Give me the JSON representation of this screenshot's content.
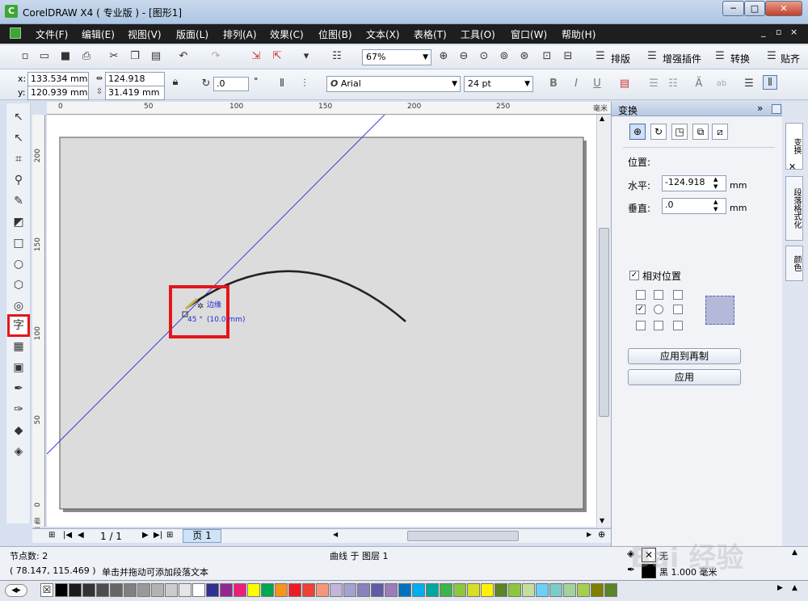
{
  "title": "CorelDRAW X4 ( 专业版 ) - [图形1]",
  "window_buttons": {
    "minimize": "─",
    "maximize": "□",
    "close": "✕"
  },
  "menu": [
    "文件(F)",
    "编辑(E)",
    "视图(V)",
    "版面(L)",
    "排列(A)",
    "效果(C)",
    "位图(B)",
    "文本(X)",
    "表格(T)",
    "工具(O)",
    "窗口(W)",
    "帮助(H)"
  ],
  "mdi_buttons": {
    "minimize": "_",
    "restore": "▫",
    "close": "×"
  },
  "standard_toolbar": {
    "zoom": "67%",
    "plugins": [
      "排版",
      "增强插件",
      "转换",
      "贴齐"
    ]
  },
  "property_bar": {
    "x_label": "x:",
    "x_value": "133.534 mm",
    "y_label": "y:",
    "y_value": "120.939 mm",
    "width_value": "124.918 mm",
    "height_value": "31.419 mm",
    "angle_value": ".0",
    "angle_unit": "°",
    "font_icon": "O",
    "font": "Arial",
    "font_size": "24 pt"
  },
  "ruler": {
    "h_labels": [
      "0",
      "50",
      "100",
      "150",
      "200",
      "250"
    ],
    "h_unit": "毫米",
    "v_labels": [
      "200",
      "150",
      "100",
      "50",
      "0"
    ],
    "v_unit": "毫米"
  },
  "canvas_overlay": {
    "snap_label": "边缘",
    "angle_label": "45 °",
    "length_label": "(10.0 mm)"
  },
  "page_nav": {
    "counter": "1 / 1",
    "tab": "页 1"
  },
  "docker": {
    "title": "变换",
    "position_label": "位置:",
    "horizontal_label": "水平:",
    "horizontal_value": "-124.918",
    "vertical_label": "垂直:",
    "vertical_value": ".0",
    "unit": "mm",
    "relative_label": "相对位置",
    "relative_checked": true,
    "apply_copy_button": "应用到再制",
    "apply_button": "应用",
    "tabs": [
      "变换",
      "段落格式化",
      "颜色"
    ]
  },
  "status": {
    "nodes": "节点数: 2",
    "layer": "曲线 于 图层 1",
    "coords": "( 78.147, 115.469 )",
    "hint": "单击并拖动可添加段落文本",
    "fill_label": "无",
    "outline_label": "黑  1.000 毫米"
  },
  "watermark": "Bai 经验",
  "palette_colors": [
    "#000000",
    "#1a1a1a",
    "#333333",
    "#4d4d4d",
    "#666666",
    "#808080",
    "#999999",
    "#b3b3b3",
    "#cccccc",
    "#e6e6e6",
    "#ffffff",
    "#2e3192",
    "#92278f",
    "#ed1e79",
    "#ffff00",
    "#00a651",
    "#f7941d",
    "#ed1c24",
    "#ef4136",
    "#f69679",
    "#c2b5d8",
    "#a3a1cf",
    "#8781bd",
    "#605ca8",
    "#9e7cb9",
    "#0072bc",
    "#00aeef",
    "#00a99d",
    "#39b54a",
    "#8dc63f",
    "#d7df23",
    "#fff200",
    "#598527",
    "#8cc63f",
    "#c4df9b",
    "#6dcff6",
    "#7accc8",
    "#a2d39c",
    "#a5cf4c",
    "#808000",
    "#598527"
  ]
}
